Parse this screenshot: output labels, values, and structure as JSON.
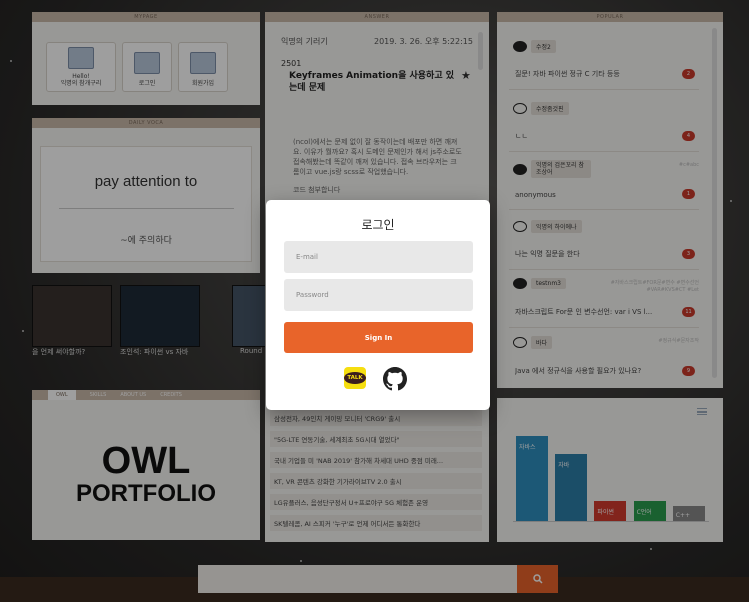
{
  "mypage": {
    "header": "MYPAGE",
    "buttons": [
      {
        "label": "Hello!\n익명의 참개구리",
        "icon": "user-icon"
      },
      {
        "label": "로그인",
        "icon": "login-icon"
      },
      {
        "label": "회원가입",
        "icon": "signup-icon"
      }
    ]
  },
  "voca": {
    "header": "DAILY VOCA",
    "word": "pay attention to",
    "meaning": "~에 주의하다"
  },
  "videos": [
    {
      "caption": "을 언제 써야할까?"
    },
    {
      "caption": "조인석: 파이썬 vs 자바"
    },
    {
      "caption": "Round"
    }
  ],
  "owl": {
    "tabs": [
      "OWL",
      "SKILLS",
      "ABOUT US",
      "CREDITS"
    ],
    "title": "OWL",
    "subtitle": "PORTFOLIO"
  },
  "answer": {
    "header": "ANSWER",
    "author": "익명의 기러기",
    "date": "2019. 3. 26. 오후 5:22:15",
    "number": "2501",
    "title": "Keyframes Animation을 사용하고 있는데 문제",
    "body": "(ncol)에서는 문제 없이 잘 동작이는데 배포만 하면 깨져요. 이유가 뭘까요? 혹시 도메인 문제인가 해서 js주소로도 접속해봤는데 똑같이 깨져 있습니다. 접속 브라우저는 크롬이고 vue.js랑 scss로 작업했습니다.",
    "code_label": "코드 첨부합니다"
  },
  "news": [
    "삼성전자, 49인치 게이밍 모니터 'CRG9' 출시",
    "\"5G-LTE 연동기술, 세계최초 5G시대 열었다\"",
    "국내 기업들 미 'NAB 2019' 참가해 차세대 UHD 중점 미래...",
    "KT, VR 콘텐츠 강화한 기가라이브TV 2.0 출시",
    "LG유플러스, 음성단구정서 U+프로야구 5G 체험존 운영",
    "SK텔레콤, AI 스피커 '누구'로 언제 어디서든 통화한다"
  ],
  "popular": {
    "header": "POPULAR",
    "items": [
      {
        "user": "수정2",
        "hash": "",
        "text": "질문! 자바 파이썬 정규 C 기타 등등",
        "count": "2",
        "filled": true
      },
      {
        "user": "수정좀것핀",
        "hash": "",
        "text": "ㄴㄴ",
        "count": "4",
        "filled": false
      },
      {
        "user": "익명의 검은꼬리 참조상어",
        "hash": "#c#abc",
        "text": "anonymous",
        "count": "1",
        "filled": true
      },
      {
        "user": "익명의 하이에나",
        "hash": "",
        "text": "나는 익명 질문을 한다",
        "count": "3",
        "filled": false
      },
      {
        "user": "testnm3",
        "hash": "#자바스크립트#FOR문#변수 #변수선언#VAR#KVS#CT #Let",
        "text": "자바스크립트 For문 인 변수선언: var i VS l...",
        "count": "11",
        "filled": true
      },
      {
        "user": "바다",
        "hash": "#정규식#문자조작",
        "text": "Java 에서 정규식을 사용할 필요가 있나요?",
        "count": "9",
        "filled": false
      }
    ]
  },
  "chart_data": {
    "type": "bar",
    "categories": [
      "자바스",
      "자바",
      "파이썬",
      "C언어",
      "C++"
    ],
    "values": [
      100,
      78,
      24,
      24,
      17
    ],
    "colors": [
      "#2e8fbf",
      "#2d7ea8",
      "#d23b2e",
      "#2a9d4e",
      "#888888"
    ],
    "title": "",
    "xlabel": "",
    "ylabel": "",
    "ylim": [
      0,
      110
    ]
  },
  "modal": {
    "title": "로그인",
    "email_placeholder": "E-mail",
    "password_placeholder": "Password",
    "signin_label": "Sign In",
    "kakao_label": "TALK"
  },
  "search": {
    "placeholder": "",
    "icon": "search-icon"
  },
  "colors": {
    "accent": "#e8642a",
    "panel_header": "#c9b8a8",
    "badge": "#c9392b"
  }
}
